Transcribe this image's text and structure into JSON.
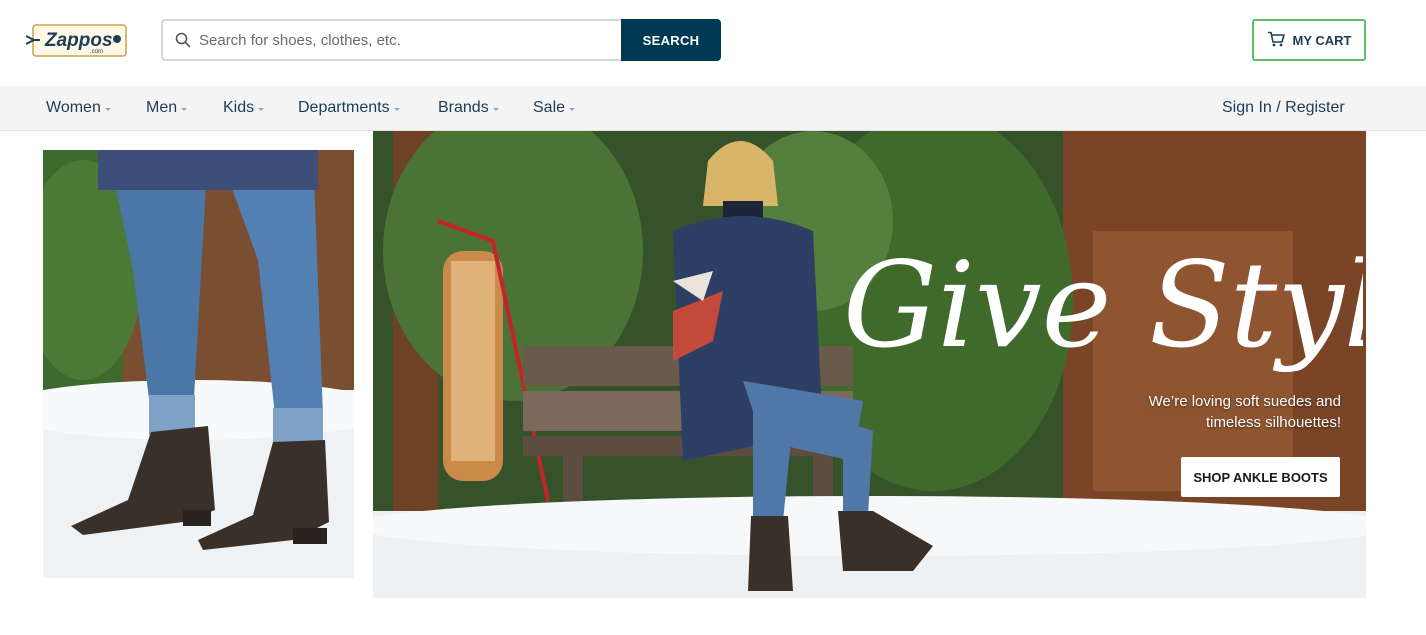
{
  "header": {
    "logo_alt": "Zappos.com",
    "search": {
      "placeholder": "Search for shoes, clothes, etc.",
      "value": "",
      "button_label": "SEARCH"
    },
    "cart_label": "MY CART"
  },
  "nav": {
    "items": [
      {
        "label": "Women"
      },
      {
        "label": "Men"
      },
      {
        "label": "Kids"
      },
      {
        "label": "Departments"
      },
      {
        "label": "Brands"
      },
      {
        "label": "Sale"
      }
    ],
    "sign_in_label": "Sign In / Register"
  },
  "hero": {
    "heading": "Give Style",
    "subtext_line1": "We’re loving soft suedes and",
    "subtext_line2": "timeless silhouettes!",
    "cta_label": "SHOP ANKLE BOOTS"
  },
  "colors": {
    "brand_navy": "#003953",
    "nav_text": "#1c3d5a",
    "cart_border": "#5cc161",
    "nav_background": "#f4f4f4"
  },
  "icons": [
    "search-icon",
    "cart-icon",
    "chevron-down-icon"
  ]
}
